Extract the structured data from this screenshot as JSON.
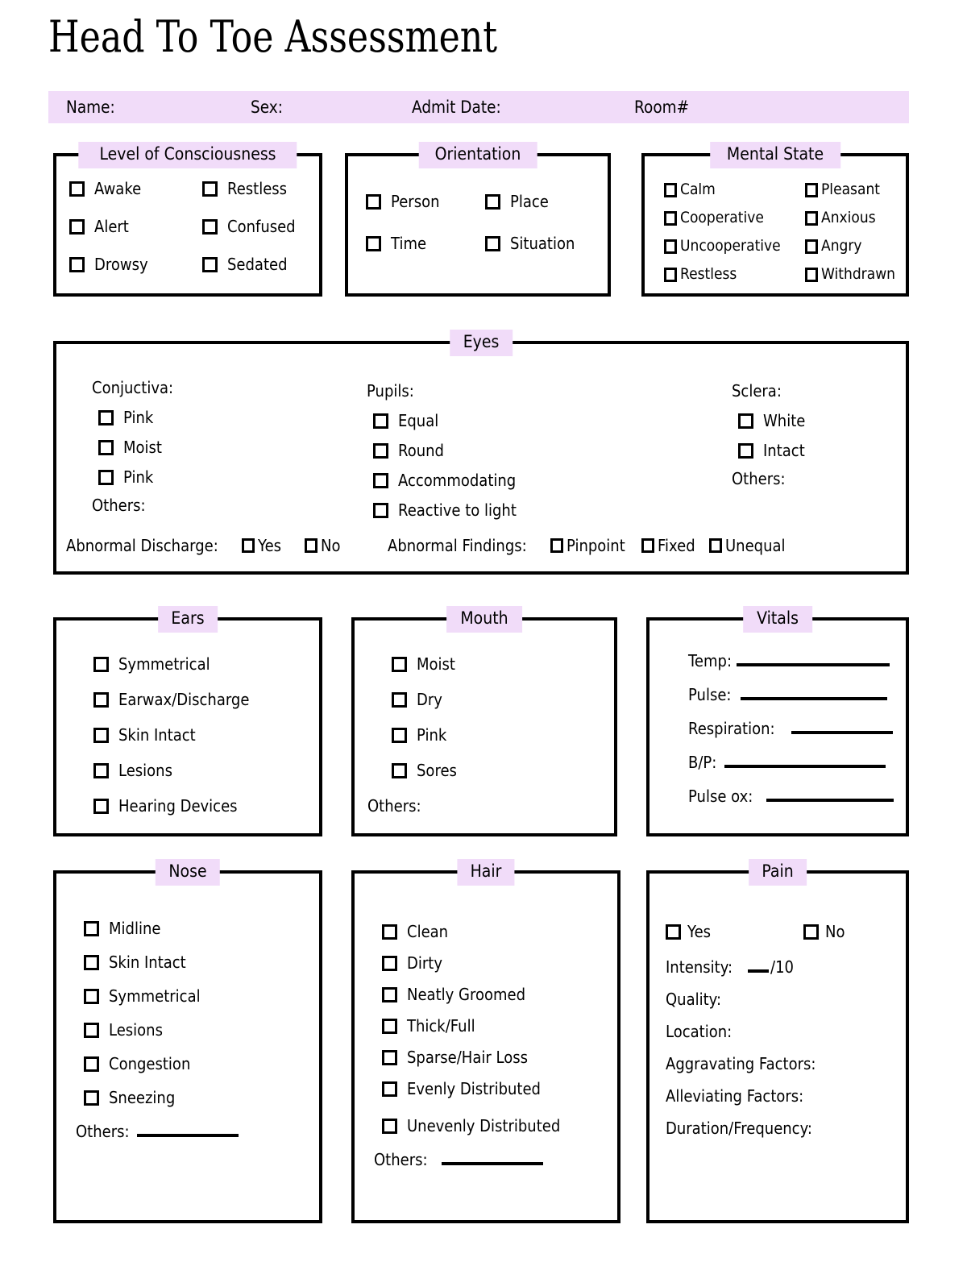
{
  "title": "Head To Toe Assessment",
  "theme": {
    "accent": "#F1DCF9",
    "ink": "#000000",
    "paper": "#FFFFFF"
  },
  "patient_bar": {
    "name_label": "Name:",
    "sex_label": "Sex:",
    "admit_label": "Admit Date:",
    "room_label": "Room#"
  },
  "sections": {
    "loc": {
      "title": "Level of Consciousness",
      "col1": [
        "Awake",
        "Alert",
        "Drowsy"
      ],
      "col2": [
        "Restless",
        "Confused",
        "Sedated"
      ]
    },
    "orientation": {
      "title": "Orientation",
      "col1": [
        "Person",
        "Time"
      ],
      "col2": [
        "Place",
        "Situation"
      ]
    },
    "mental_state": {
      "title": "Mental State",
      "col1": [
        "Calm",
        "Cooperative",
        "Uncooperative",
        "Restless"
      ],
      "col2": [
        "Pleasant",
        "Anxious",
        "Angry",
        "Withdrawn"
      ]
    },
    "eyes": {
      "title": "Eyes",
      "conjuctiva": {
        "label": "Conjuctiva:",
        "items": [
          "Pink",
          "Moist",
          "Pink"
        ],
        "others_label": "Others:"
      },
      "pupils": {
        "label": "Pupils:",
        "items": [
          "Equal",
          "Round",
          "Accommodating",
          "Reactive to light"
        ]
      },
      "sclera": {
        "label": "Sclera:",
        "items": [
          "White",
          "Intact"
        ],
        "others_label": "Others:"
      },
      "abnormal_discharge": {
        "label": "Abnormal Discharge:",
        "options": [
          "Yes",
          "No"
        ]
      },
      "abnormal_findings": {
        "label": "Abnormal Findings:",
        "options": [
          "Pinpoint",
          "Fixed",
          "Unequal"
        ]
      }
    },
    "ears": {
      "title": "Ears",
      "items": [
        "Symmetrical",
        "Earwax/Discharge",
        "Skin Intact",
        "Lesions",
        "Hearing Devices"
      ]
    },
    "mouth": {
      "title": "Mouth",
      "items": [
        "Moist",
        "Dry",
        "Pink",
        "Sores"
      ],
      "others_label": "Others:"
    },
    "vitals": {
      "title": "Vitals",
      "fields": [
        "Temp:",
        "Pulse:",
        "Respiration:",
        "B/P:",
        "Pulse ox:"
      ]
    },
    "nose": {
      "title": "Nose",
      "items": [
        "Midline",
        "Skin Intact",
        "Symmetrical",
        "Lesions",
        "Congestion",
        "Sneezing"
      ],
      "others_label": "Others:"
    },
    "hair": {
      "title": "Hair",
      "items": [
        "Clean",
        "Dirty",
        "Neatly Groomed",
        "Thick/Full",
        "Sparse/Hair Loss",
        "Evenly Distributed",
        "Unevenly Distributed"
      ],
      "others_label": "Others:"
    },
    "pain": {
      "title": "Pain",
      "options": [
        "Yes",
        "No"
      ],
      "intensity_label": "Intensity:",
      "intensity_suffix": "/10",
      "fields": [
        "Quality:",
        "Location:",
        "Aggravating Factors:",
        "Alleviating Factors:",
        "Duration/Frequency:"
      ]
    }
  }
}
